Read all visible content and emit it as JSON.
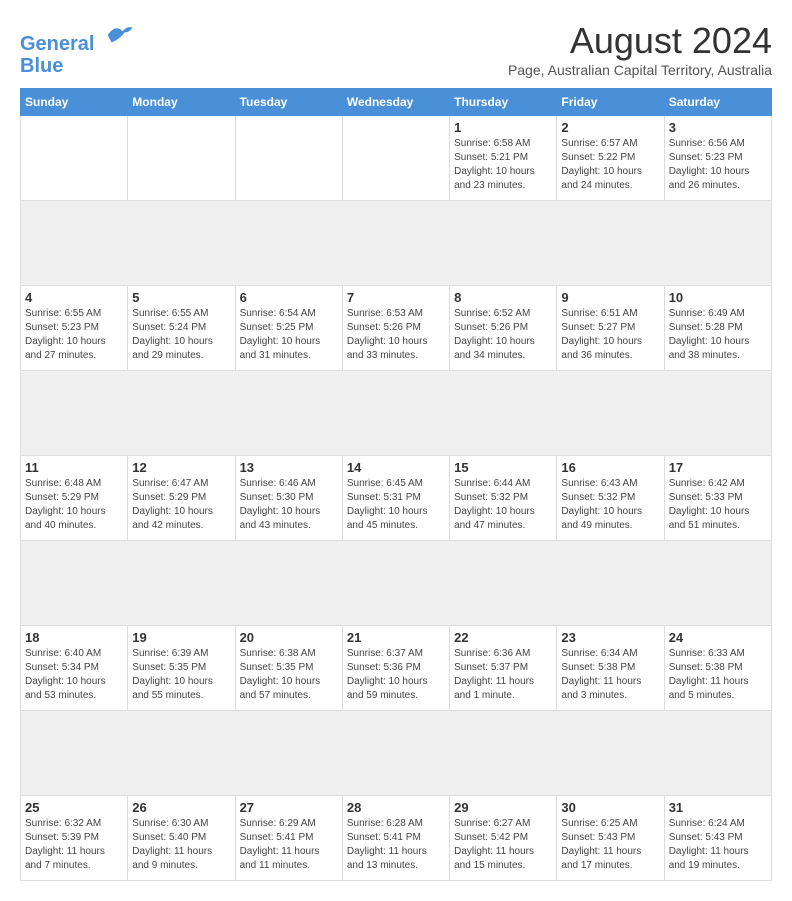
{
  "header": {
    "logo_line1": "General",
    "logo_line2": "Blue",
    "month_year": "August 2024",
    "location": "Page, Australian Capital Territory, Australia"
  },
  "days_of_week": [
    "Sunday",
    "Monday",
    "Tuesday",
    "Wednesday",
    "Thursday",
    "Friday",
    "Saturday"
  ],
  "weeks": [
    [
      {
        "day": "",
        "info": ""
      },
      {
        "day": "",
        "info": ""
      },
      {
        "day": "",
        "info": ""
      },
      {
        "day": "",
        "info": ""
      },
      {
        "day": "1",
        "info": "Sunrise: 6:58 AM\nSunset: 5:21 PM\nDaylight: 10 hours\nand 23 minutes."
      },
      {
        "day": "2",
        "info": "Sunrise: 6:57 AM\nSunset: 5:22 PM\nDaylight: 10 hours\nand 24 minutes."
      },
      {
        "day": "3",
        "info": "Sunrise: 6:56 AM\nSunset: 5:23 PM\nDaylight: 10 hours\nand 26 minutes."
      }
    ],
    [
      {
        "day": "4",
        "info": "Sunrise: 6:55 AM\nSunset: 5:23 PM\nDaylight: 10 hours\nand 27 minutes."
      },
      {
        "day": "5",
        "info": "Sunrise: 6:55 AM\nSunset: 5:24 PM\nDaylight: 10 hours\nand 29 minutes."
      },
      {
        "day": "6",
        "info": "Sunrise: 6:54 AM\nSunset: 5:25 PM\nDaylight: 10 hours\nand 31 minutes."
      },
      {
        "day": "7",
        "info": "Sunrise: 6:53 AM\nSunset: 5:26 PM\nDaylight: 10 hours\nand 33 minutes."
      },
      {
        "day": "8",
        "info": "Sunrise: 6:52 AM\nSunset: 5:26 PM\nDaylight: 10 hours\nand 34 minutes."
      },
      {
        "day": "9",
        "info": "Sunrise: 6:51 AM\nSunset: 5:27 PM\nDaylight: 10 hours\nand 36 minutes."
      },
      {
        "day": "10",
        "info": "Sunrise: 6:49 AM\nSunset: 5:28 PM\nDaylight: 10 hours\nand 38 minutes."
      }
    ],
    [
      {
        "day": "11",
        "info": "Sunrise: 6:48 AM\nSunset: 5:29 PM\nDaylight: 10 hours\nand 40 minutes."
      },
      {
        "day": "12",
        "info": "Sunrise: 6:47 AM\nSunset: 5:29 PM\nDaylight: 10 hours\nand 42 minutes."
      },
      {
        "day": "13",
        "info": "Sunrise: 6:46 AM\nSunset: 5:30 PM\nDaylight: 10 hours\nand 43 minutes."
      },
      {
        "day": "14",
        "info": "Sunrise: 6:45 AM\nSunset: 5:31 PM\nDaylight: 10 hours\nand 45 minutes."
      },
      {
        "day": "15",
        "info": "Sunrise: 6:44 AM\nSunset: 5:32 PM\nDaylight: 10 hours\nand 47 minutes."
      },
      {
        "day": "16",
        "info": "Sunrise: 6:43 AM\nSunset: 5:32 PM\nDaylight: 10 hours\nand 49 minutes."
      },
      {
        "day": "17",
        "info": "Sunrise: 6:42 AM\nSunset: 5:33 PM\nDaylight: 10 hours\nand 51 minutes."
      }
    ],
    [
      {
        "day": "18",
        "info": "Sunrise: 6:40 AM\nSunset: 5:34 PM\nDaylight: 10 hours\nand 53 minutes."
      },
      {
        "day": "19",
        "info": "Sunrise: 6:39 AM\nSunset: 5:35 PM\nDaylight: 10 hours\nand 55 minutes."
      },
      {
        "day": "20",
        "info": "Sunrise: 6:38 AM\nSunset: 5:35 PM\nDaylight: 10 hours\nand 57 minutes."
      },
      {
        "day": "21",
        "info": "Sunrise: 6:37 AM\nSunset: 5:36 PM\nDaylight: 10 hours\nand 59 minutes."
      },
      {
        "day": "22",
        "info": "Sunrise: 6:36 AM\nSunset: 5:37 PM\nDaylight: 11 hours\nand 1 minute."
      },
      {
        "day": "23",
        "info": "Sunrise: 6:34 AM\nSunset: 5:38 PM\nDaylight: 11 hours\nand 3 minutes."
      },
      {
        "day": "24",
        "info": "Sunrise: 6:33 AM\nSunset: 5:38 PM\nDaylight: 11 hours\nand 5 minutes."
      }
    ],
    [
      {
        "day": "25",
        "info": "Sunrise: 6:32 AM\nSunset: 5:39 PM\nDaylight: 11 hours\nand 7 minutes."
      },
      {
        "day": "26",
        "info": "Sunrise: 6:30 AM\nSunset: 5:40 PM\nDaylight: 11 hours\nand 9 minutes."
      },
      {
        "day": "27",
        "info": "Sunrise: 6:29 AM\nSunset: 5:41 PM\nDaylight: 11 hours\nand 11 minutes."
      },
      {
        "day": "28",
        "info": "Sunrise: 6:28 AM\nSunset: 5:41 PM\nDaylight: 11 hours\nand 13 minutes."
      },
      {
        "day": "29",
        "info": "Sunrise: 6:27 AM\nSunset: 5:42 PM\nDaylight: 11 hours\nand 15 minutes."
      },
      {
        "day": "30",
        "info": "Sunrise: 6:25 AM\nSunset: 5:43 PM\nDaylight: 11 hours\nand 17 minutes."
      },
      {
        "day": "31",
        "info": "Sunrise: 6:24 AM\nSunset: 5:43 PM\nDaylight: 11 hours\nand 19 minutes."
      }
    ]
  ]
}
